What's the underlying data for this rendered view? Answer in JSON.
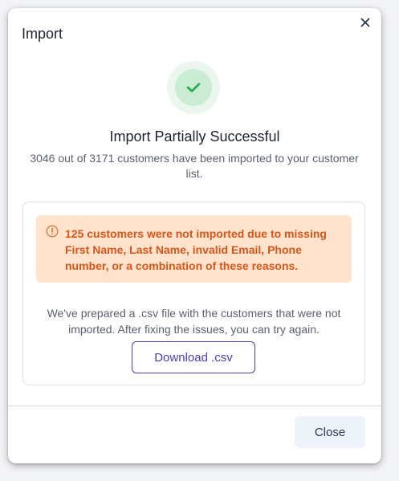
{
  "dialog": {
    "title": "Import",
    "close_icon": "close-icon"
  },
  "result": {
    "status_icon": "check-icon",
    "headline": "Import Partially Successful",
    "summary": "3046 out of 3171 customers have been imported to your customer list."
  },
  "warning": {
    "icon": "alert-circle-icon",
    "message": "125 customers were not imported due to missing First Name, Last Name, invalid Email, Phone number, or a combination of these reasons."
  },
  "details": {
    "info": "We've prepared a .csv file with the customers that were not imported. After fixing the issues, you can try again.",
    "download_label": "Download .csv"
  },
  "footer": {
    "close_label": "Close"
  },
  "colors": {
    "accent": "#4b3db2",
    "success": "#22a84a",
    "warning_bg": "#ffe3cc",
    "warning_text": "#d5561a"
  }
}
